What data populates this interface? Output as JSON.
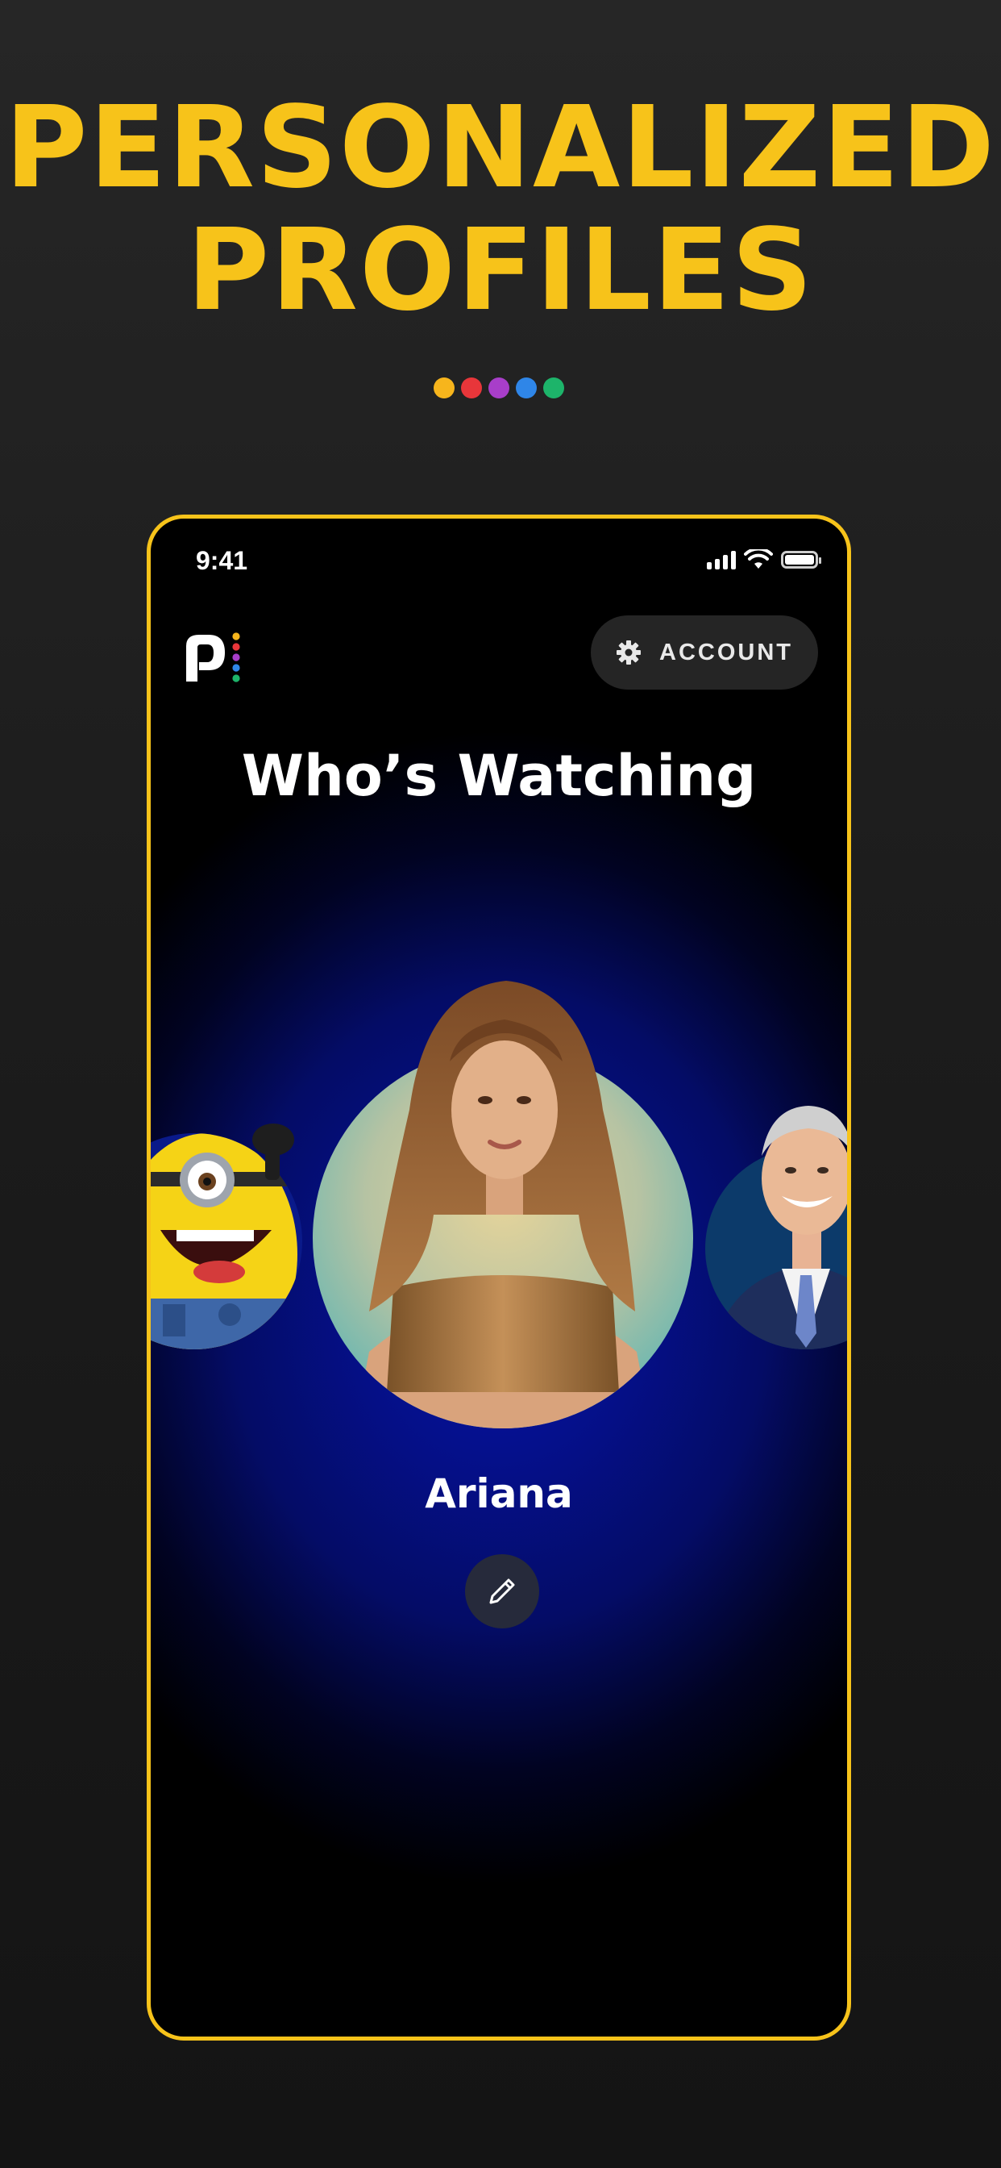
{
  "headline": {
    "line1": "PERSONALIZED",
    "line2": "PROFILES"
  },
  "pager_dots": [
    {
      "color": "#f7b51c"
    },
    {
      "color": "#e8363a"
    },
    {
      "color": "#a83ec9"
    },
    {
      "color": "#2f86e8"
    },
    {
      "color": "#1db46a"
    }
  ],
  "status_bar": {
    "time": "9:41"
  },
  "header": {
    "logo_icon": "peacock-logo-icon",
    "account_label": "ACCOUNT",
    "account_icon": "gear-icon"
  },
  "title": "Who’s Watching",
  "profiles": {
    "selected_name": "Ariana",
    "edit_icon": "pencil-icon"
  },
  "colors": {
    "accent": "#f7c31a",
    "background": "#1f1f1f",
    "phone_bg": "#000000",
    "glow": "#0614a8"
  }
}
